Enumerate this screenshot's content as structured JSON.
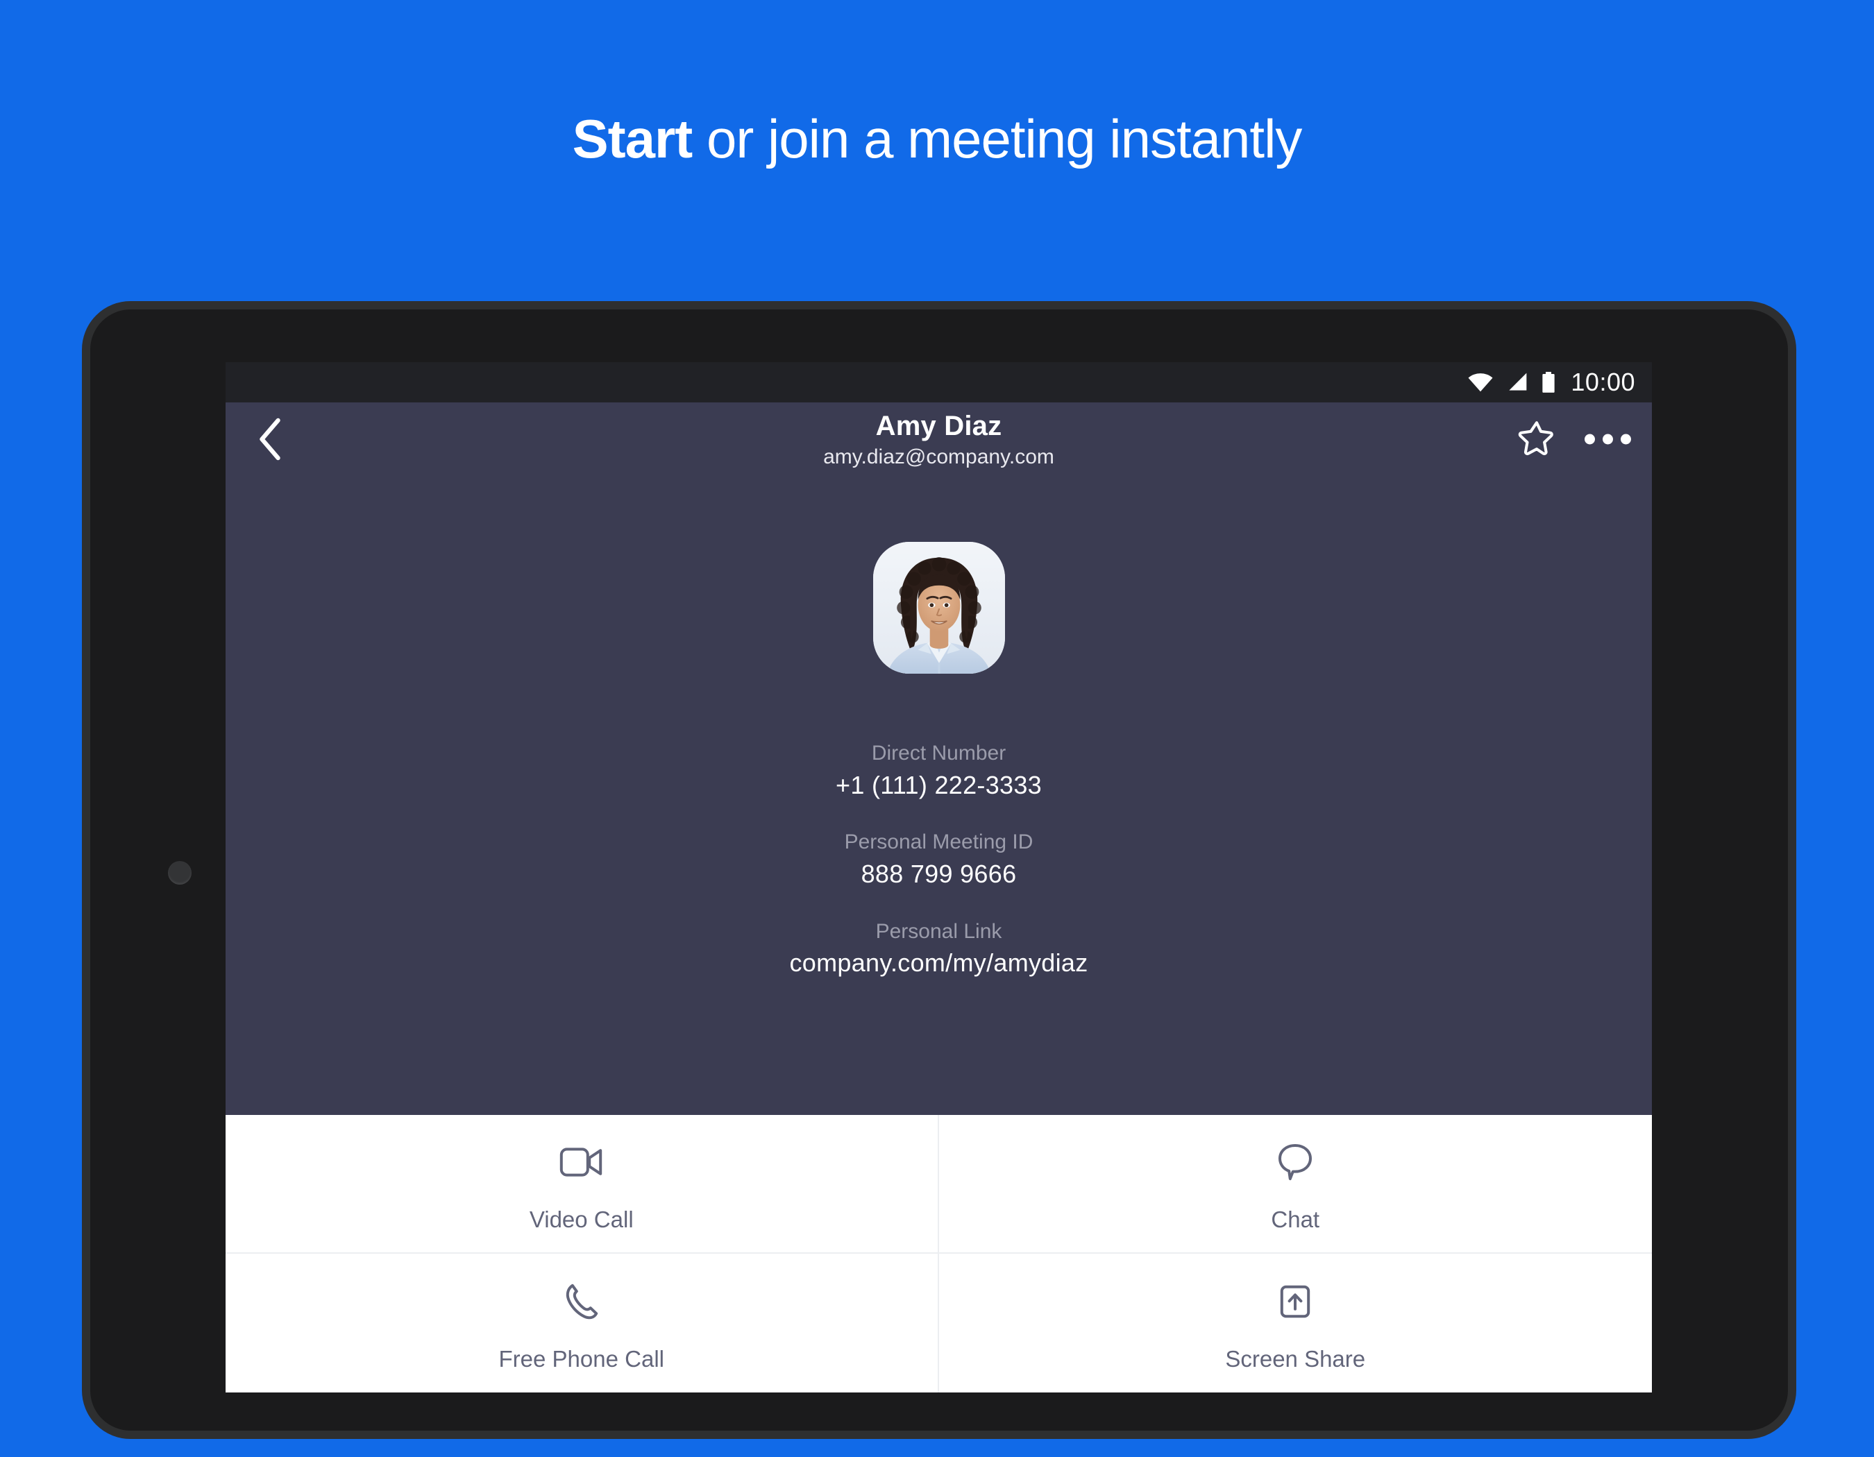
{
  "headline": {
    "bold": "Start",
    "rest": " or join a meeting instantly"
  },
  "colors": {
    "background_blue": "#116ae8",
    "screen_dark": "#3b3c52",
    "statusbar_dark": "#212226",
    "panel_white": "#ffffff",
    "label_gray": "#9b9cab",
    "action_label_gray": "#62657a",
    "bezel_dark": "#1b1b1c",
    "bezel_outline": "#2e2f30"
  },
  "statusbar": {
    "time": "10:00",
    "icons": [
      "wifi-icon",
      "cellular-signal-icon",
      "battery-icon"
    ]
  },
  "appbar": {
    "back_icon": "chevron-left-icon",
    "title": "Amy Diaz",
    "subtitle": "amy.diaz@company.com",
    "favorite_icon": "star-outline-icon",
    "overflow_icon": "more-options-icon"
  },
  "profile": {
    "avatar_alt": "Amy Diaz profile photo",
    "fields": [
      {
        "label": "Direct Number",
        "value": "+1 (111) 222-3333"
      },
      {
        "label": "Personal Meeting ID",
        "value": "888 799 9666"
      },
      {
        "label": "Personal Link",
        "value": "company.com/my/amydiaz"
      }
    ]
  },
  "actions": [
    {
      "label": "Video Call",
      "icon": "video-camera-icon"
    },
    {
      "label": "Chat",
      "icon": "chat-bubble-icon"
    },
    {
      "label": "Free Phone Call",
      "icon": "phone-handset-icon"
    },
    {
      "label": "Screen Share",
      "icon": "screen-share-icon"
    }
  ]
}
